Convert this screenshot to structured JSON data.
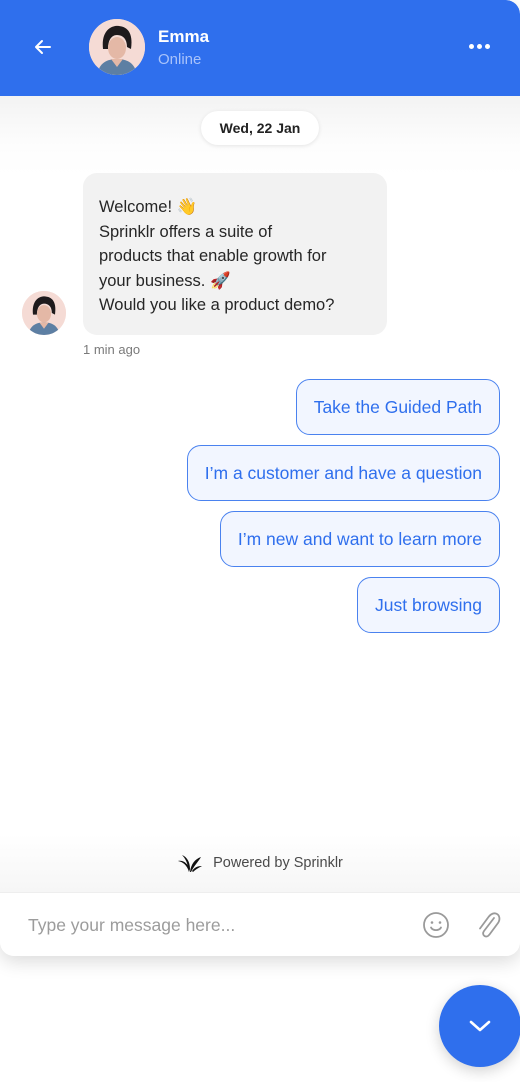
{
  "header": {
    "name": "Emma",
    "status": "Online",
    "back_icon": "arrow-left-icon",
    "more_icon": "more-horizontal-icon"
  },
  "conversation": {
    "date_label": "Wed, 22 Jan",
    "message": {
      "lines": [
        "Welcome! 👋",
        "Sprinklr offers a suite of",
        "products that enable growth for",
        "your business. 🚀",
        "Would you like a product demo?"
      ],
      "timestamp": "1 min ago"
    },
    "quick_replies": [
      "Take the Guided Path",
      "I’m a customer and have a question",
      "I’m new and want to learn more",
      "Just browsing"
    ]
  },
  "footer": {
    "powered_by": "Powered by Sprinklr"
  },
  "composer": {
    "placeholder": "Type your message here...",
    "value": "",
    "emoji_icon": "smiley-icon",
    "attach_icon": "paperclip-icon"
  },
  "colors": {
    "brand": "#2f6fed",
    "quick_reply_bg": "#f2f6ff",
    "bubble_bg": "#f2f2f2"
  }
}
